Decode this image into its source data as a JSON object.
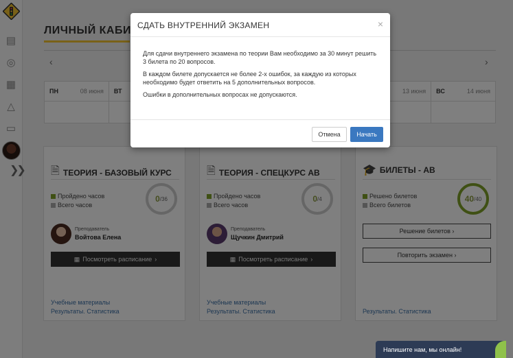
{
  "page": {
    "title": "ЛИЧНЫЙ КАБИН",
    "calendar": {
      "days": [
        {
          "name": "ПН",
          "date": "08 июня"
        },
        {
          "name": "ВТ",
          "date": ""
        },
        {
          "name": "",
          "date": ""
        },
        {
          "name": "",
          "date": ""
        },
        {
          "name": "",
          "date": ""
        },
        {
          "name": "",
          "date": "13 июня"
        },
        {
          "name": "ВС",
          "date": "14 июня"
        }
      ]
    },
    "cards": [
      {
        "title": "ТЕОРИЯ - БАЗОВЫЙ КУРС",
        "stat1": "Пройдено часов",
        "stat2": "Всего часов",
        "done": "0",
        "total": "/36",
        "teacher_role": "Преподаватель",
        "teacher_name": "Войтова Елена",
        "button": "Посмотреть расписание",
        "link1": "Учебные материалы",
        "link2": "Результаты. Статистика"
      },
      {
        "title": "ТЕОРИЯ - СПЕЦКУРС АВ",
        "stat1": "Пройдено часов",
        "stat2": "Всего часов",
        "done": "0",
        "total": "/4",
        "teacher_role": "Преподаватель",
        "teacher_name": "Щучкин Дмитрий",
        "button": "Посмотреть расписание",
        "link1": "Учебные материалы",
        "link2": "Результаты. Статистика"
      },
      {
        "title": "БИЛЕТЫ - АВ",
        "stat1": "Решено билетов",
        "stat2": "Всего билетов",
        "done": "40",
        "total": "/40",
        "button1": "Решение билетов",
        "button2": "Повторить экзамен",
        "link2": "Результаты. Статистика"
      }
    ]
  },
  "modal": {
    "title": "СДАТЬ ВНУТРЕННИЙ ЭКЗАМЕН",
    "close": "×",
    "p1": "Для сдачи внутреннего экзамена по теории Вам необходимо за 30 минут решить 3 билета по 20 вопросов.",
    "p2": "В каждом билете допускается не более 2-х ошибок, за каждую из которых необходимо будет ответить на 5 дополнительных вопросов.",
    "p3": "Ошибки в дополнительных вопросах не допускаются.",
    "cancel": "Отмена",
    "start": "Начать"
  },
  "chat": {
    "label": "Напишите нам, мы онлайн!"
  },
  "colors": {
    "accent": "#f2c230",
    "primary_button": "#3a78c0",
    "ring_done": "#7fa128",
    "link": "#3a6ea5",
    "chat_bg": "#2d3b55"
  },
  "icons": [
    "logo-icon",
    "document-icon",
    "globe-icon",
    "calendar-icon",
    "bell-icon",
    "wallet-icon",
    "expand-icon",
    "chevron-left-icon",
    "chevron-right-icon",
    "file-icon",
    "graduation-cap-icon",
    "calendar-small-icon",
    "close-icon"
  ]
}
